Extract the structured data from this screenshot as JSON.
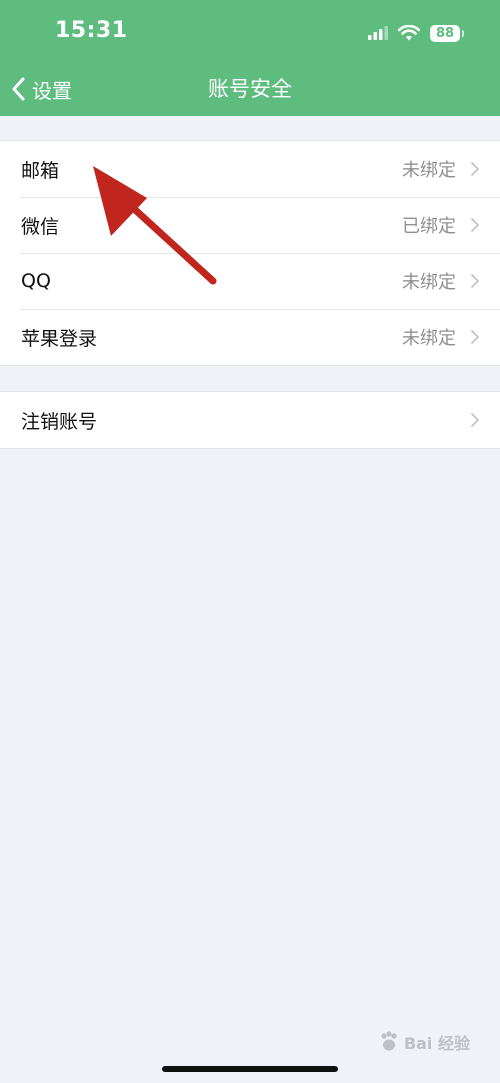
{
  "status_bar": {
    "time": "15:31",
    "battery": "88"
  },
  "nav": {
    "back_label": "设置",
    "title": "账号安全"
  },
  "bindings": [
    {
      "label": "邮箱",
      "value": "未绑定"
    },
    {
      "label": "微信",
      "value": "已绑定"
    },
    {
      "label": "QQ",
      "value": "未绑定"
    },
    {
      "label": "苹果登录",
      "value": "未绑定"
    }
  ],
  "account": {
    "cancel_label": "注销账号"
  },
  "watermark": "Bai 经验",
  "colors": {
    "header": "#5fbc7f",
    "background": "#eff2f7",
    "annotation_arrow": "#c0261e"
  }
}
